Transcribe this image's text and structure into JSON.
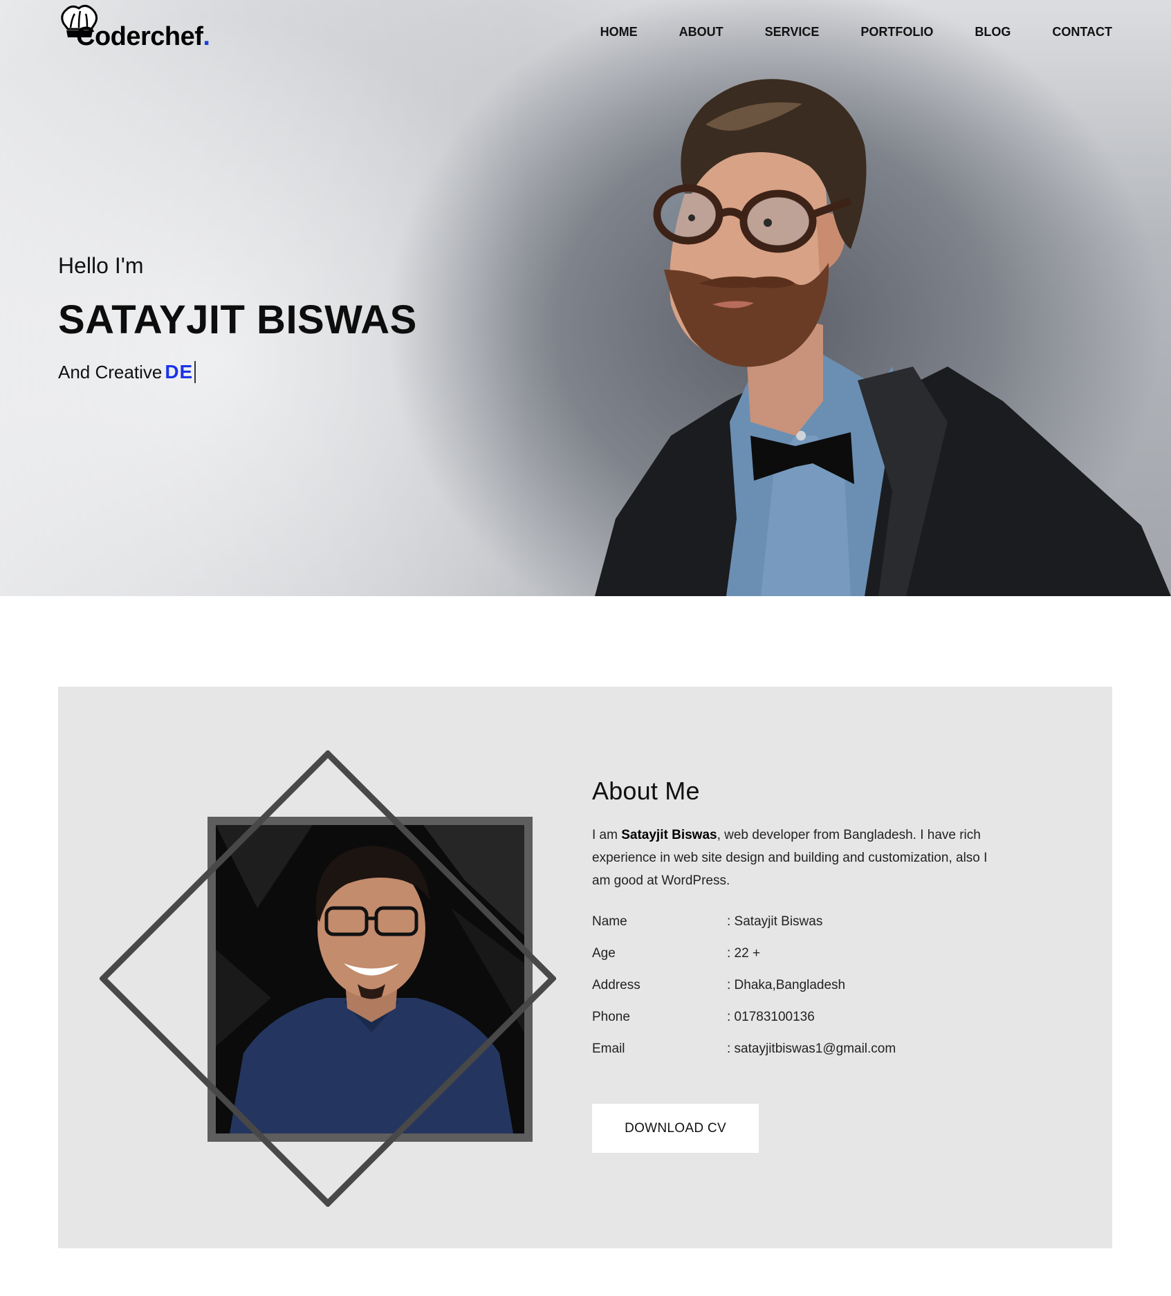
{
  "brand": {
    "logo_text": "Coderchef",
    "logo_dot": ".",
    "accent": "#1a33e8"
  },
  "nav": {
    "items": [
      {
        "label": "HOME"
      },
      {
        "label": "ABOUT"
      },
      {
        "label": "SERVICE"
      },
      {
        "label": "PORTFOLIO"
      },
      {
        "label": "BLOG"
      },
      {
        "label": "CONTACT"
      }
    ]
  },
  "hero": {
    "greeting": "Hello I'm",
    "name": "SATAYJIT BISWAS",
    "tagline_prefix": "And Creative",
    "typed_text": "DE"
  },
  "about": {
    "title": "About Me",
    "desc_prefix": "I am ",
    "desc_name": "Satayjit Biswas",
    "desc_rest": ", web developer from Bangladesh. I have rich experience in web site design and building and customization, also I am good at WordPress.",
    "info": [
      {
        "label": "Name",
        "value": ": Satayjit Biswas"
      },
      {
        "label": "Age",
        "value": ": 22 +"
      },
      {
        "label": "Address",
        "value": ": Dhaka,Bangladesh"
      },
      {
        "label": "Phone",
        "value": ": 01783100136"
      },
      {
        "label": "Email",
        "value": ": satayjitbiswas1@gmail.com"
      }
    ],
    "button_label": "DOWNLOAD CV"
  }
}
